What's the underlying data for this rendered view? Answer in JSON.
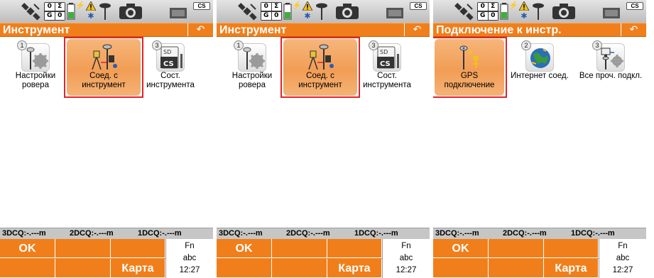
{
  "status": {
    "quality": [
      "0",
      "Σ",
      "0",
      "G",
      "0"
    ],
    "cs_badge": "CS"
  },
  "cq": {
    "3d": "3DCQ:-.---m",
    "2d": "2DCQ:-.---m",
    "1d": "1DCQ:-.---m"
  },
  "softkeys": {
    "ok": "OK",
    "map": "Карта",
    "fn": "Fn",
    "abc": "abc",
    "time": "12:27"
  },
  "screens": [
    {
      "title": "Инструмент",
      "items": [
        {
          "num": "1",
          "label1": "Настройки",
          "label2": "ровера",
          "icon": "rover-settings-icon"
        },
        {
          "num": "",
          "label1": "Соед. с",
          "label2": "инструмент",
          "icon": "instrument-connection-icon",
          "selected": true
        },
        {
          "num": "3",
          "label1": "Сост.",
          "label2": "инструмента",
          "icon": "instrument-status-icon",
          "badge_top": "SD",
          "badge": "CS"
        }
      ]
    },
    {
      "title": "Инструмент",
      "items": [
        {
          "num": "1",
          "label1": "Настройки",
          "label2": "ровера",
          "icon": "rover-settings-icon"
        },
        {
          "num": "",
          "label1": "Соед. с",
          "label2": "инструмент",
          "icon": "instrument-connection-icon",
          "selected": true
        },
        {
          "num": "3",
          "label1": "Сост.",
          "label2": "инструмента",
          "icon": "instrument-status-icon",
          "badge_top": "SD",
          "badge": "CS"
        }
      ]
    },
    {
      "title": "Подключение к инстр.",
      "items": [
        {
          "num": "",
          "label1": "GPS",
          "label2": "подключение",
          "icon": "gps-connection-icon",
          "selected": true
        },
        {
          "num": "2",
          "label1": "Интернет соед.",
          "label2": "",
          "icon": "internet-connection-icon"
        },
        {
          "num": "3",
          "label1": "Все проч. подкл.",
          "label2": "",
          "icon": "other-connections-icon"
        }
      ]
    }
  ],
  "colors": {
    "accent": "#f07f1b",
    "selection_border": "#e0242b",
    "status_bar": "#cfcfcf"
  }
}
